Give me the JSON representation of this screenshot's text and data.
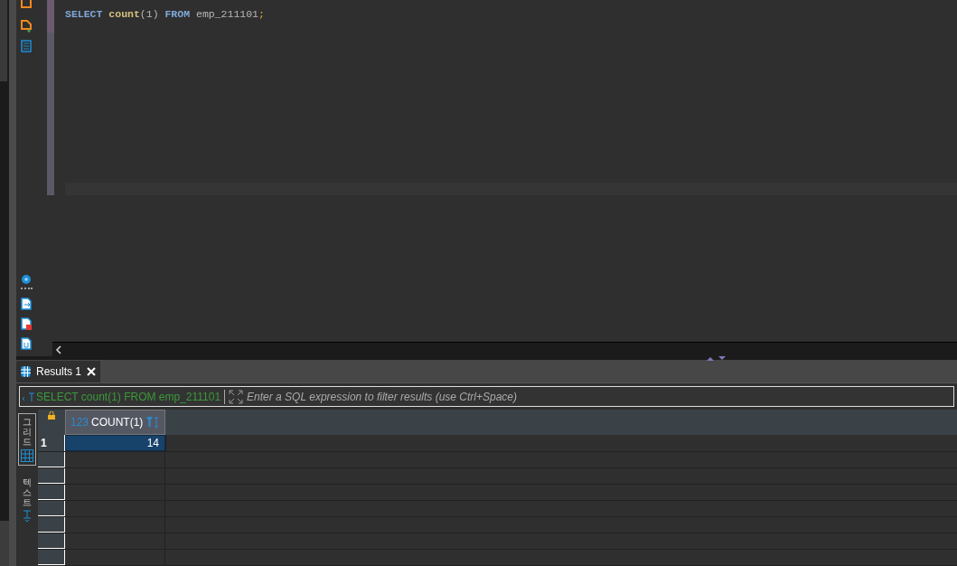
{
  "editor": {
    "words": [
      [
        {
          "kind": "keyword",
          "text": "SELECT"
        }
      ],
      [
        {
          "kind": "function",
          "text": "count"
        },
        {
          "kind": "plain",
          "text": "(1)"
        }
      ],
      [
        {
          "kind": "keyword",
          "text": "FROM"
        }
      ],
      [
        {
          "kind": "plain",
          "text": "emp_211101"
        },
        {
          "kind": "punct",
          "text": ";"
        }
      ]
    ]
  },
  "results": {
    "tabs": [
      {
        "label": "Results 1",
        "selected": true
      }
    ],
    "filter": {
      "query": "SELECT count(1) FROM emp_211101",
      "placeholder": "Enter a SQL expression to filter results (use Ctrl+Space)"
    },
    "side_tabs": [
      {
        "label": "그리드",
        "selected": true
      },
      {
        "label": "텍스트",
        "selected": false
      }
    ],
    "columns": [
      {
        "type_tag": "123",
        "name": "COUNT(1)"
      }
    ],
    "rows": [
      {
        "number": "1",
        "selected": true,
        "cells": [
          "14"
        ]
      }
    ]
  }
}
